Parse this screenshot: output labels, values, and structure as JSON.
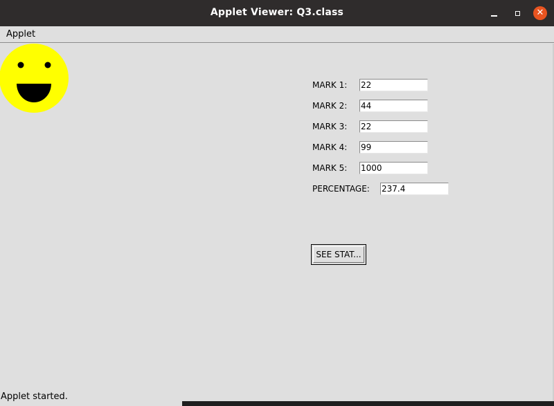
{
  "window": {
    "title": "Applet Viewer: Q3.class",
    "controls": {
      "minimize_icon": "minimize-icon",
      "maximize_icon": "maximize-icon",
      "close_icon": "close-icon",
      "close_glyph": "✕",
      "close_color": "#e95420"
    }
  },
  "menubar": {
    "items": [
      {
        "label": "Applet"
      }
    ]
  },
  "drawing": {
    "face_icon": "smiley-face-icon",
    "face_color": "#ffff00",
    "feature_color": "#000000"
  },
  "form": {
    "marks": [
      {
        "label": "MARK 1:",
        "value": "22"
      },
      {
        "label": "MARK 2:",
        "value": "44"
      },
      {
        "label": "MARK 3:",
        "value": "22"
      },
      {
        "label": "MARK 4:",
        "value": "99"
      },
      {
        "label": "MARK 5:",
        "value": "1000"
      }
    ],
    "percentage": {
      "label": "PERCENTAGE:",
      "value": "237.4"
    },
    "button_label": "SEE STAT..."
  },
  "status": {
    "text": "Applet started."
  }
}
